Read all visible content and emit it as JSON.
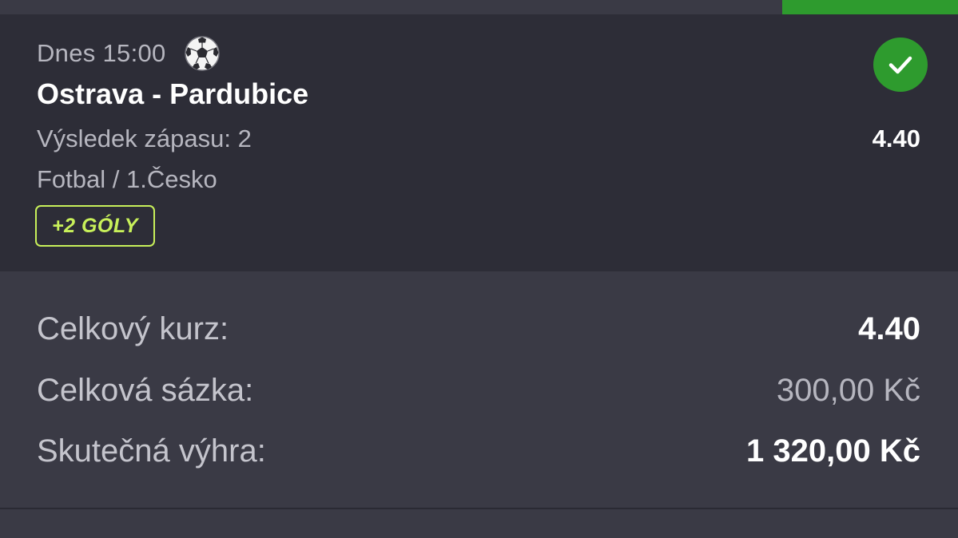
{
  "colors": {
    "background": "#3a3a45",
    "card": "#2d2d37",
    "accent_green": "#2e9b2e",
    "status_bar": "#2e9b2e",
    "promo": "#c8f05a"
  },
  "bet": {
    "datetime": "Dnes 15:00",
    "sport_icon": "soccer-ball-icon",
    "match": "Ostrava - Pardubice",
    "market": "Výsledek zápasu: 2",
    "league": "Fotbal / 1.Česko",
    "promo_badge": "+2 GÓLY",
    "odds": "4.40",
    "status_icon": "checkmark-icon"
  },
  "summary": {
    "total_odds_label": "Celkový kurz:",
    "total_odds_value": "4.40",
    "total_stake_label": "Celková sázka:",
    "total_stake_value": "300,00 Kč",
    "actual_win_label": "Skutečná výhra:",
    "actual_win_value": "1 320,00 Kč"
  }
}
